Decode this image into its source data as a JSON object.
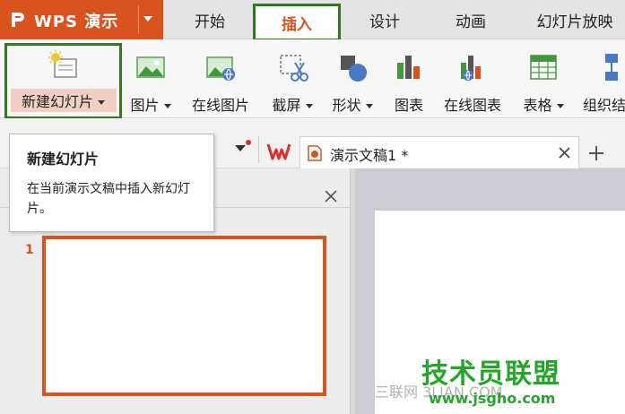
{
  "app": {
    "name": "WPS 演示",
    "brand_color": "#d9531e"
  },
  "menu": {
    "tabs": [
      {
        "label": "开始"
      },
      {
        "label": "插入"
      },
      {
        "label": "设计"
      },
      {
        "label": "动画"
      },
      {
        "label": "幻灯片放映"
      }
    ]
  },
  "ribbon": {
    "new_slide": "新建幻灯片",
    "picture": "图片",
    "online_picture": "在线图片",
    "screenshot": "截屏",
    "shape": "形状",
    "chart": "图表",
    "online_chart": "在线图表",
    "table": "表格",
    "smartart": "组织结"
  },
  "document": {
    "tab_title": "演示文稿1 *"
  },
  "tooltip": {
    "title": "新建幻灯片",
    "body": "在当前演示文稿中插入新幻灯片。"
  },
  "slides": {
    "thumb_number": "1"
  },
  "watermark": {
    "main": "技术员联盟",
    "url": "www.jsgho.com",
    "faint": "三联网 3LIAN.COM"
  },
  "colors": {
    "highlight_green": "#2c7b1e",
    "watermark_green": "#25a52b"
  }
}
